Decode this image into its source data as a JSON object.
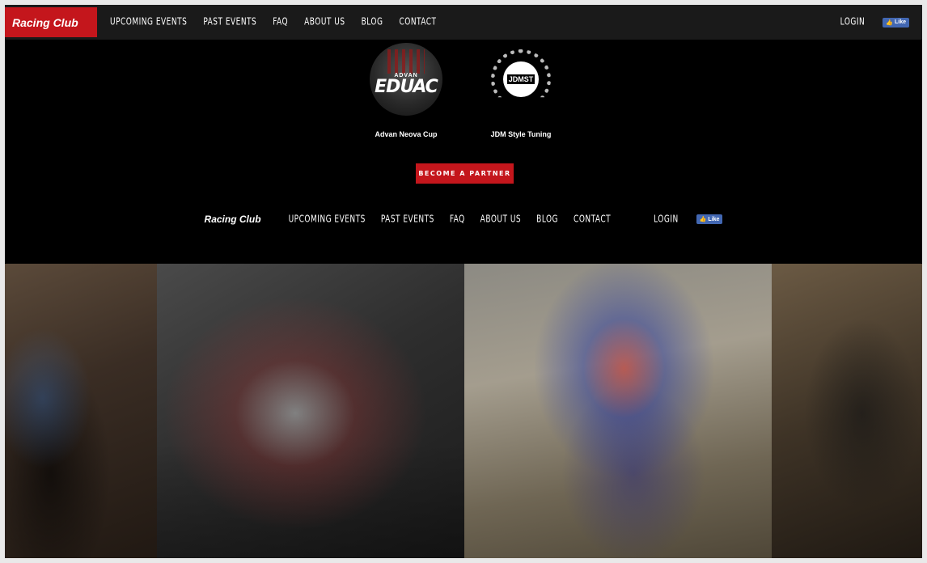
{
  "topnav": {
    "brand": "Racing Club",
    "links": [
      "UPCOMING EVENTS",
      "PAST EVENTS",
      "FAQ",
      "ABOUT US",
      "BLOG",
      "CONTACT"
    ],
    "login": "LOGIN",
    "fb_like": "Like"
  },
  "partners": [
    {
      "name": "Advan Neova Cup",
      "logo_top": "ADVAN",
      "logo_text": "EDUAC"
    },
    {
      "name": "JDM Style Tuning",
      "logo_text": "JDMST"
    }
  ],
  "partner_button": "BECOME A PARTNER",
  "footnav": {
    "brand": "Racing Club",
    "links": [
      "UPCOMING EVENTS",
      "PAST EVENTS",
      "FAQ",
      "ABOUT US",
      "BLOG",
      "CONTACT"
    ],
    "login": "LOGIN",
    "fb_like": "Like"
  },
  "colors": {
    "accent": "#c4161c",
    "facebook": "#4267b2",
    "background": "#000000"
  }
}
